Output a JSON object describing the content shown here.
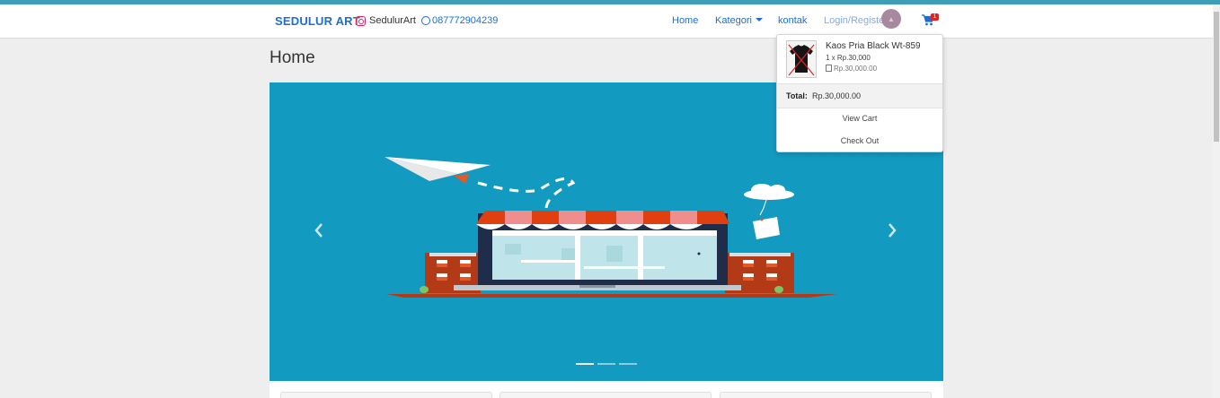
{
  "navbar": {
    "brand": "SEDULUR ART",
    "instagram_handle": "SedulurArt",
    "whatsapp_number": "087772904239",
    "links": [
      {
        "label": "Home"
      },
      {
        "label": "Kategori"
      },
      {
        "label": "kontak"
      },
      {
        "label": "Login/Register"
      }
    ],
    "cart_count": "1"
  },
  "page": {
    "title": "Home"
  },
  "carousel": {
    "slides": 3,
    "active_slide": 1
  },
  "cart_dropdown": {
    "item_name": "Kaos Pria Black Wt-859",
    "item_qty": "1 x Rp.30,000",
    "item_price": "Rp.30,000.00",
    "total_label": "Total:",
    "total_value": "Rp.30,000.00",
    "view_cart": "View Cart",
    "check_out": "Check Out"
  },
  "colors": {
    "brand": "#1c6fd1",
    "carousel_bg": "#139ac1",
    "awning_red": "#e0400f",
    "building_brick": "#b33a17"
  }
}
